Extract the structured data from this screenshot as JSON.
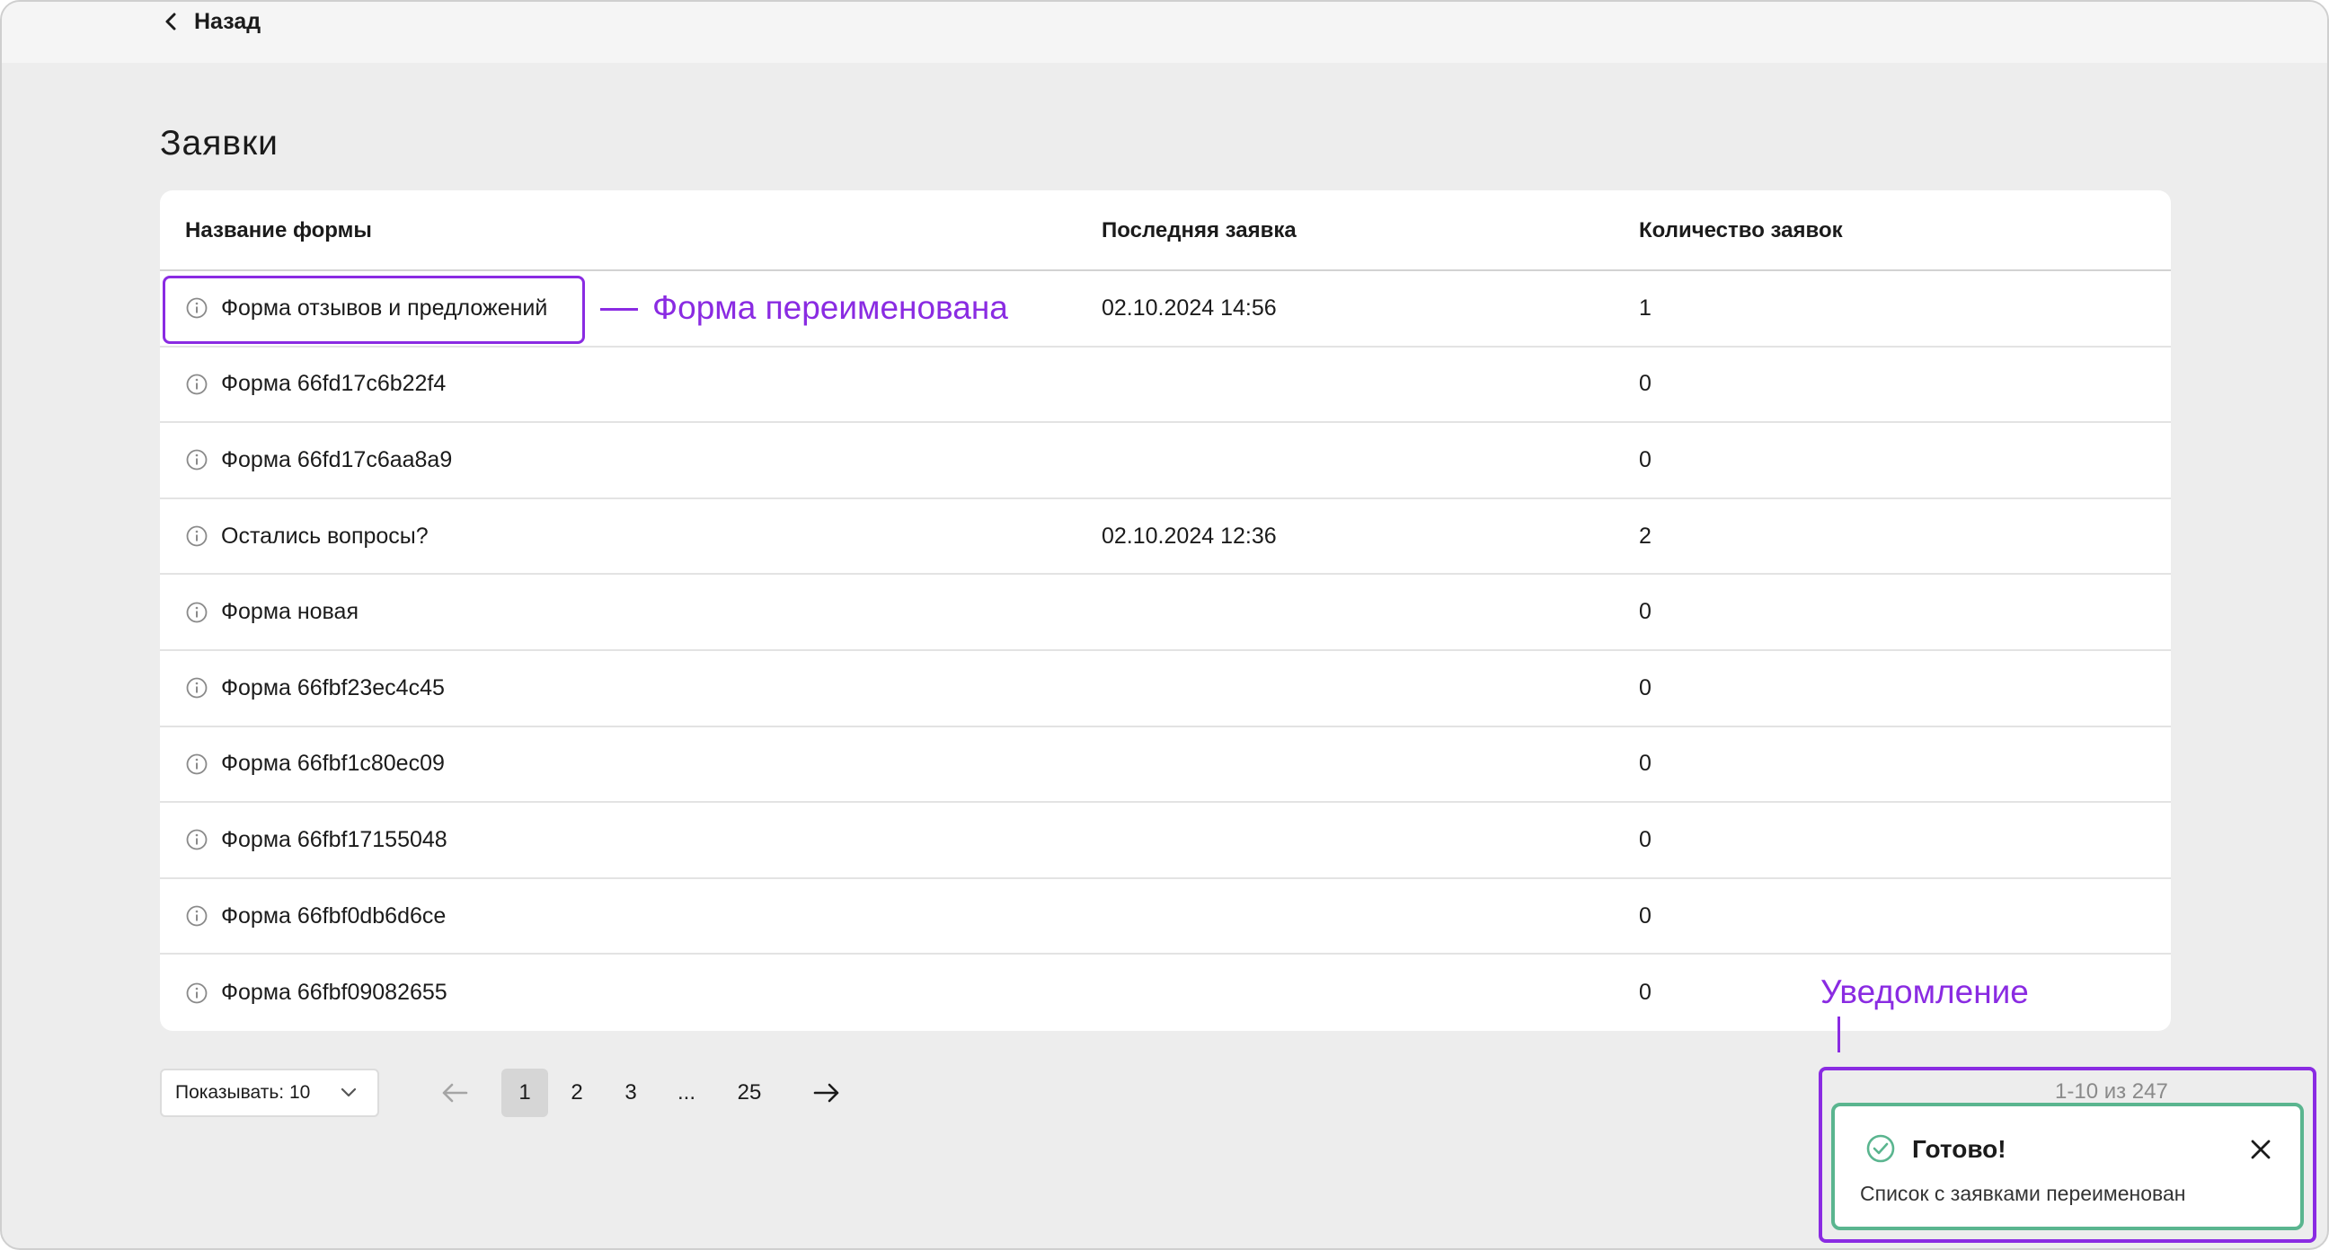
{
  "header": {
    "back_label": "Назад"
  },
  "page": {
    "title": "Заявки"
  },
  "table": {
    "columns": [
      "Название формы",
      "Последняя заявка",
      "Количество заявок"
    ],
    "rows": [
      {
        "name": "Форма отзывов и предложений",
        "last_request": "02.10.2024 14:56",
        "count": "1"
      },
      {
        "name": "Форма 66fd17c6b22f4",
        "last_request": "",
        "count": "0"
      },
      {
        "name": "Форма 66fd17c6aa8a9",
        "last_request": "",
        "count": "0"
      },
      {
        "name": "Остались вопросы?",
        "last_request": "02.10.2024 12:36",
        "count": "2"
      },
      {
        "name": "Форма новая",
        "last_request": "",
        "count": "0"
      },
      {
        "name": "Форма 66fbf23ec4c45",
        "last_request": "",
        "count": "0"
      },
      {
        "name": "Форма 66fbf1c80ec09",
        "last_request": "",
        "count": "0"
      },
      {
        "name": "Форма 66fbf17155048",
        "last_request": "",
        "count": "0"
      },
      {
        "name": "Форма 66fbf0db6d6ce",
        "last_request": "",
        "count": "0"
      },
      {
        "name": "Форма 66fbf09082655",
        "last_request": "",
        "count": "0"
      }
    ]
  },
  "pagination": {
    "page_size_label": "Показывать: 10",
    "pages": [
      "1",
      "2",
      "3",
      "...",
      "25"
    ],
    "current_page": "1",
    "range_text": "1-10 из 247"
  },
  "toast": {
    "title": "Готово!",
    "message": "Список с заявками переименован"
  },
  "annotations": {
    "renamed": "Форма переименована",
    "notification": "Уведомление"
  },
  "colors": {
    "annotation": "#8a2be2",
    "success": "#5ab58f",
    "background": "#ededed"
  },
  "icons": {
    "back": "chevron-left-icon",
    "row_info": "info-icon",
    "dropdown": "chevron-down-icon",
    "prev": "arrow-left-icon",
    "next": "arrow-right-icon",
    "toast_status": "check-circle-icon",
    "toast_close": "close-icon"
  }
}
